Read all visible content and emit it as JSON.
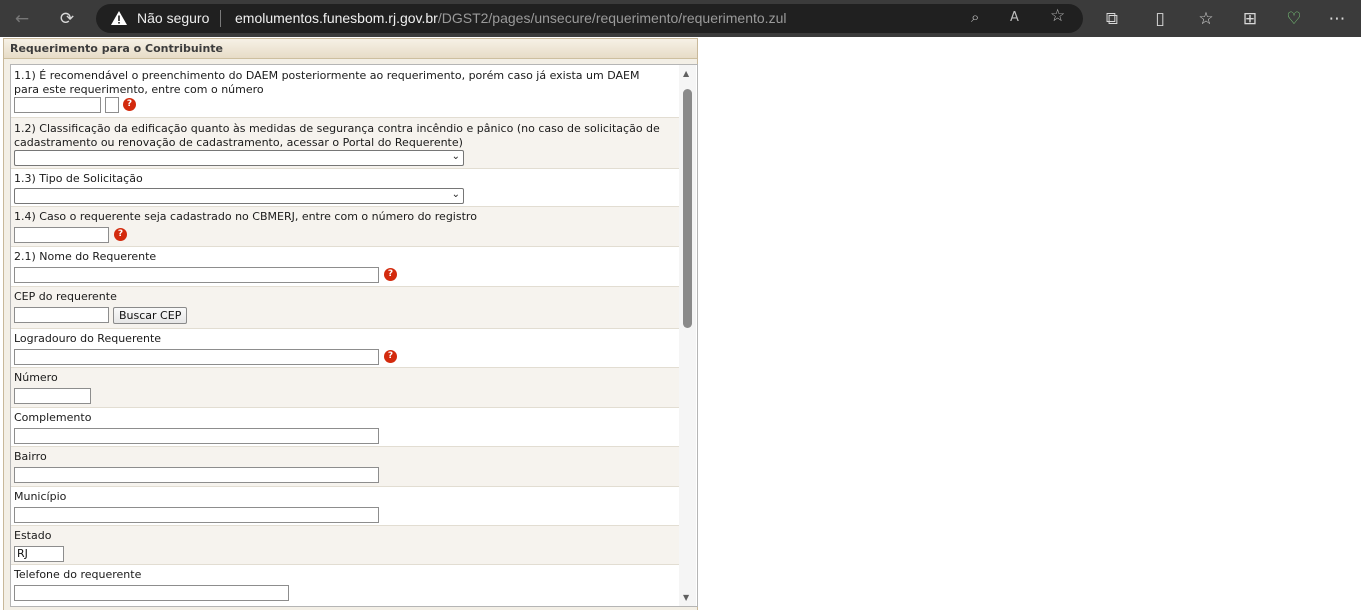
{
  "browser": {
    "security_label": "Não seguro",
    "url_host": "emolumentos.funesbom.rj.gov.br",
    "url_path": "/DGST2/pages/unsecure/requerimento/requerimento.zul",
    "icons": {
      "back": "←",
      "reload": "⟳",
      "zoom": "⌕",
      "read_aloud": "A",
      "favorite": "☆",
      "extensions": "⧉",
      "split": "▯",
      "favorites": "☆",
      "collections": "⊞",
      "health": "♡",
      "more": "⋯"
    }
  },
  "panel": {
    "title": "Requerimento para o Contribuinte"
  },
  "form": {
    "q11_label": "1.1) É recomendável o preenchimento do DAEM posteriormente ao requerimento, porém caso já exista um DAEM para este requerimento, entre com o número",
    "q12_label": "1.2) Classificação da edificação quanto às medidas de segurança contra incêndio e pânico (no caso de solicitação de cadastramento ou renovação de cadastramento, acessar o Portal do Requerente)",
    "q12_value": "",
    "q13_label": "1.3) Tipo de Solicitação",
    "q13_value": "",
    "q14_label": "1.4) Caso o requerente seja cadastrado no CBMERJ, entre com o número do registro",
    "q21_label": "2.1) Nome do Requerente",
    "cep_label": "CEP do requerente",
    "cep_button": "Buscar CEP",
    "logradouro_label": "Logradouro do Requerente",
    "numero_label": "Número",
    "complemento_label": "Complemento",
    "bairro_label": "Bairro",
    "municipio_label": "Município",
    "estado_label": "Estado",
    "estado_value": "RJ",
    "telefone_label": "Telefone do requerente",
    "help_glyph": "?",
    "select_arrow": "⌄"
  },
  "scrollbar": {
    "up": "▲",
    "down": "▼"
  }
}
